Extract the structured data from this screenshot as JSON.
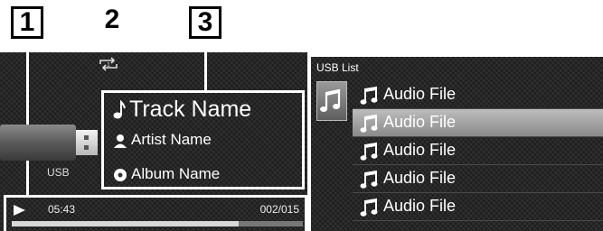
{
  "callouts": [
    "1",
    "2",
    "3"
  ],
  "player": {
    "device_label": "USB",
    "track_name": "Track Name",
    "artist_name": "Artist Name",
    "album_name": "Album Name",
    "elapsed": "05:43",
    "track_count": "002/015",
    "progress_fraction": 0.78
  },
  "list": {
    "title": "USB List",
    "items": [
      "Audio File",
      "Audio File",
      "Audio File",
      "Audio File",
      "Audio File"
    ],
    "selected_index": 1
  },
  "icons": {
    "repeat": "repeat-one-icon",
    "play": "play-icon",
    "note": "music-note-icon",
    "artist": "person-icon",
    "album": "disc-icon",
    "folder": "music-folder-icon"
  }
}
